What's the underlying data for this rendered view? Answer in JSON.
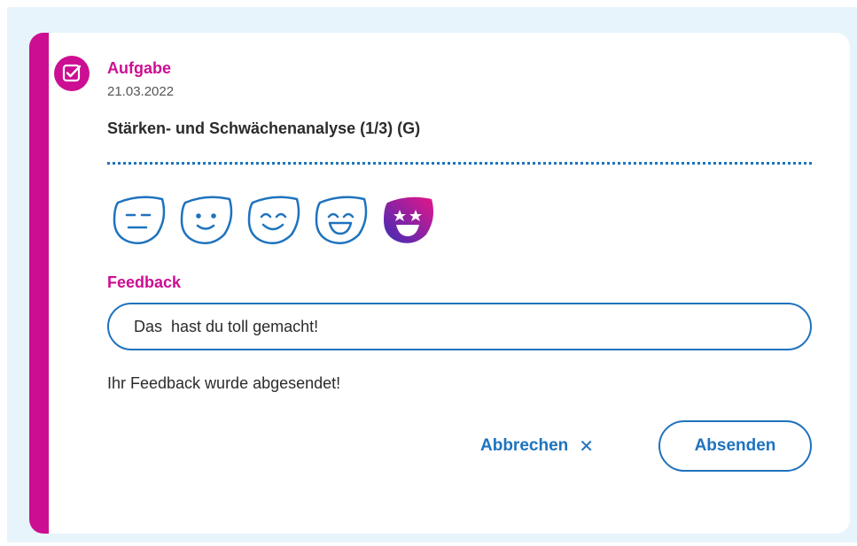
{
  "task": {
    "type_label": "Aufgabe",
    "date": "21.03.2022",
    "title": "Stärken- und Schwächenanalyse (1/3) (G)",
    "type_icon": "checkbox-icon"
  },
  "rating": {
    "options": [
      "neutral-face-icon",
      "slight-smile-face-icon",
      "happy-face-icon",
      "grinning-face-icon",
      "star-struck-face-icon"
    ],
    "selected_index": 4
  },
  "feedback": {
    "label": "Feedback",
    "value": "Das  hast du toll gemacht!",
    "status": "Ihr Feedback wurde abgesendet!"
  },
  "actions": {
    "cancel_label": "Abbrechen",
    "cancel_icon": "✕",
    "submit_label": "Absenden"
  },
  "colors": {
    "accent": "#cc0e92",
    "primary": "#1e73be",
    "selected_gradient_start": "#e4168a",
    "selected_gradient_end": "#3b2db8",
    "background": "#e8f4fb"
  }
}
